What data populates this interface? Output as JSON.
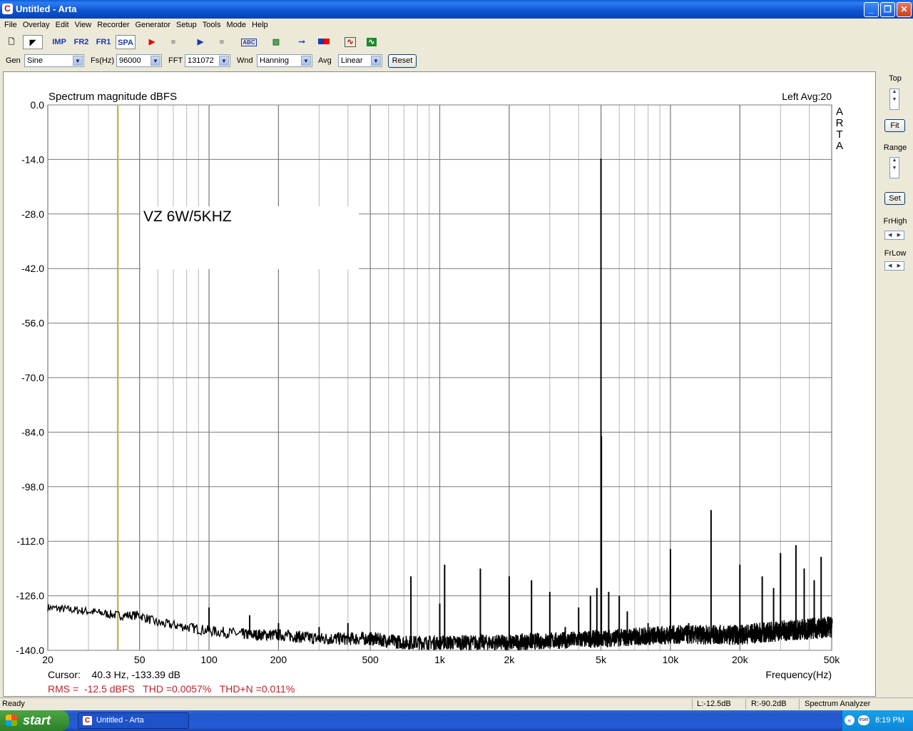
{
  "window": {
    "title": "Untitled - Arta",
    "app_icon_letter": "C"
  },
  "menu": [
    "File",
    "Overlay",
    "Edit",
    "View",
    "Recorder",
    "Generator",
    "Setup",
    "Tools",
    "Mode",
    "Help"
  ],
  "toolbar": {
    "buttons": [
      {
        "name": "new-doc-icon"
      },
      {
        "name": "pir-mode-icon"
      },
      {
        "name": "imp",
        "label": "IMP"
      },
      {
        "name": "fr2",
        "label": "FR2"
      },
      {
        "name": "fr1",
        "label": "FR1"
      },
      {
        "name": "spa",
        "label": "SPA"
      },
      {
        "name": "record-icon"
      },
      {
        "name": "stop-icon"
      },
      {
        "name": "play-icon"
      },
      {
        "name": "stop2-icon"
      },
      {
        "name": "abc-icon"
      },
      {
        "name": "hatch-icon"
      },
      {
        "name": "slider-icon"
      },
      {
        "name": "level-icon"
      },
      {
        "name": "sine-icon"
      },
      {
        "name": "scope-icon"
      }
    ]
  },
  "toolbar2": {
    "gen_label": "Gen",
    "gen_value": "Sine",
    "fs_label": "Fs(Hz)",
    "fs_value": "96000",
    "fft_label": "FFT",
    "fft_value": "131072",
    "wnd_label": "Wnd",
    "wnd_value": "Hanning",
    "avg_label": "Avg",
    "avg_value": "Linear",
    "reset_label": "Reset"
  },
  "right_panel": {
    "top_label": "Top",
    "fit_label": "Fit",
    "range_label": "Range",
    "set_label": "Set",
    "frhigh_label": "FrHigh",
    "frlow_label": "FrLow"
  },
  "chart_data": {
    "type": "line",
    "title": "Spectrum magnitude dBFS",
    "channel_info": "Left  Avg:20",
    "watermark": "ARTA",
    "annotation": "VZ 6W/5KHZ",
    "xlabel": "Frequency(Hz)",
    "x_scale": "log",
    "xlim": [
      20,
      50000
    ],
    "ylim": [
      -140,
      0
    ],
    "x_ticks": [
      {
        "v": 20,
        "label": "20"
      },
      {
        "v": 50,
        "label": "50"
      },
      {
        "v": 100,
        "label": "100"
      },
      {
        "v": 200,
        "label": "200"
      },
      {
        "v": 500,
        "label": "500"
      },
      {
        "v": 1000,
        "label": "1k"
      },
      {
        "v": 2000,
        "label": "2k"
      },
      {
        "v": 5000,
        "label": "5k"
      },
      {
        "v": 10000,
        "label": "10k"
      },
      {
        "v": 20000,
        "label": "20k"
      },
      {
        "v": 50000,
        "label": "50k"
      }
    ],
    "y_ticks": [
      "0.0",
      "-14.0",
      "-28.0",
      "-42.0",
      "-56.0",
      "-70.0",
      "-84.0",
      "-98.0",
      "-112.0",
      "-126.0",
      "-140.0"
    ],
    "grid": true,
    "cursor": {
      "freq": 40.3,
      "level": -133.39,
      "color": "#c8b45a"
    },
    "cursor_text": "Cursor:    40.3 Hz, -133.39 dB",
    "stats_text": "RMS =  -12.5 dBFS   THD =0.0057%   THD+N =0.011%",
    "series": [
      {
        "color": "#000000",
        "noise_floor": [
          [
            20,
            -129
          ],
          [
            30,
            -130
          ],
          [
            40,
            -131
          ],
          [
            50,
            -131
          ],
          [
            60,
            -133
          ],
          [
            80,
            -134
          ],
          [
            100,
            -135
          ],
          [
            150,
            -136
          ],
          [
            200,
            -136
          ],
          [
            300,
            -137
          ],
          [
            500,
            -137
          ],
          [
            700,
            -138
          ],
          [
            1000,
            -138
          ],
          [
            2000,
            -138
          ],
          [
            5000,
            -137
          ],
          [
            10000,
            -136
          ],
          [
            20000,
            -136
          ],
          [
            30000,
            -135
          ],
          [
            50000,
            -134
          ]
        ],
        "peaks": [
          [
            100,
            -129
          ],
          [
            150,
            -131
          ],
          [
            200,
            -133
          ],
          [
            300,
            -134
          ],
          [
            400,
            -133
          ],
          [
            750,
            -121
          ],
          [
            1000,
            -128
          ],
          [
            1050,
            -118
          ],
          [
            1500,
            -119
          ],
          [
            2000,
            -121
          ],
          [
            2500,
            -122
          ],
          [
            3000,
            -125
          ],
          [
            3500,
            -134
          ],
          [
            4000,
            -129
          ],
          [
            4500,
            -126
          ],
          [
            4800,
            -124
          ],
          [
            5000,
            -13.8
          ],
          [
            5020,
            -85
          ],
          [
            5400,
            -125
          ],
          [
            6000,
            -126
          ],
          [
            6500,
            -130
          ],
          [
            8000,
            -133
          ],
          [
            10000,
            -114
          ],
          [
            12000,
            -133
          ],
          [
            15000,
            -104
          ],
          [
            20000,
            -118
          ],
          [
            25000,
            -121
          ],
          [
            28000,
            -124
          ],
          [
            30000,
            -115
          ],
          [
            35000,
            -113
          ],
          [
            38000,
            -119
          ],
          [
            42000,
            -122
          ],
          [
            45000,
            -116
          ]
        ]
      }
    ]
  },
  "status": {
    "left": "Ready",
    "l_level": "L:-12.5dB",
    "r_level": "R:-90.2dB",
    "mode": "Spectrum Analyzer"
  },
  "taskbar": {
    "start_label": "start",
    "task_label": "Untitled - Arta",
    "clock": "8:19 PM"
  }
}
